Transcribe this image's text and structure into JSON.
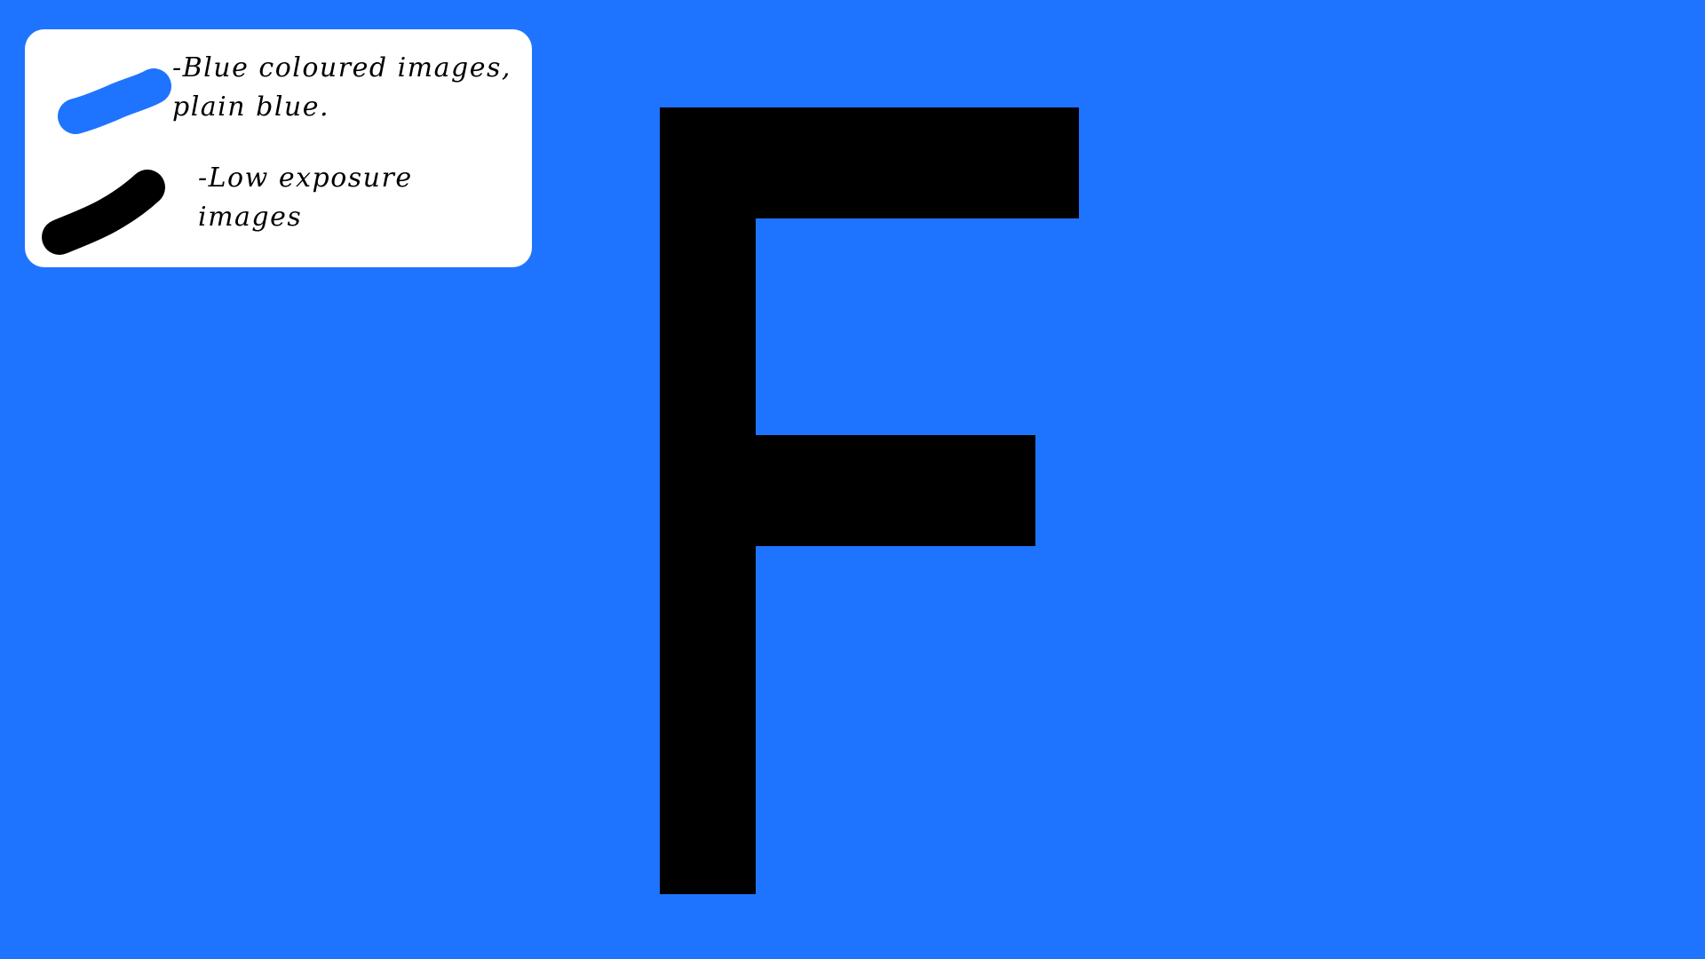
{
  "background_color": "#1f74ff",
  "letter": {
    "glyph": "F",
    "color": "#000000"
  },
  "legend": {
    "items": [
      {
        "swatch_color": "#1f74ff",
        "lines": [
          "-Blue coloured images,",
          "plain blue."
        ]
      },
      {
        "swatch_color": "#000000",
        "lines": [
          "-Low exposure",
          "images"
        ]
      }
    ]
  }
}
